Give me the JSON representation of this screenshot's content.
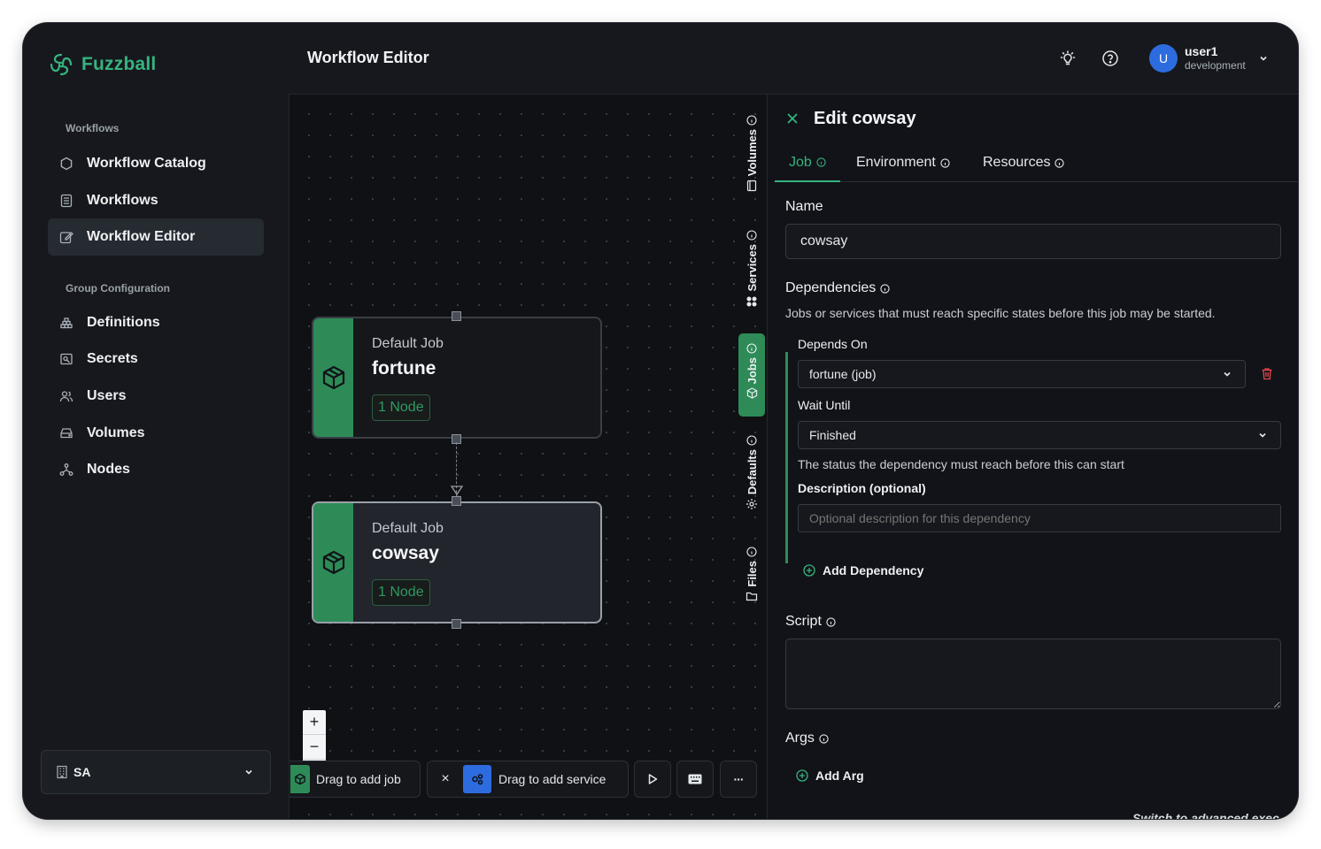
{
  "brand": {
    "name": "Fuzzball",
    "color": "#36b37e"
  },
  "sidebar": {
    "workflows_label": "Workflows",
    "workflows": [
      {
        "label": "Workflow Catalog",
        "icon": "hexagon-icon"
      },
      {
        "label": "Workflows",
        "icon": "list-icon"
      },
      {
        "label": "Workflow Editor",
        "icon": "edit-icon",
        "active": true
      }
    ],
    "group_label": "Group Configuration",
    "group": [
      {
        "label": "Definitions",
        "icon": "stack-icon"
      },
      {
        "label": "Secrets",
        "icon": "secret-icon"
      },
      {
        "label": "Users",
        "icon": "users-icon"
      },
      {
        "label": "Volumes",
        "icon": "drive-icon"
      },
      {
        "label": "Nodes",
        "icon": "nodes-icon"
      }
    ],
    "org": "SA"
  },
  "header": {
    "title": "Workflow Editor",
    "user": {
      "initial": "U",
      "name": "user1",
      "org": "development"
    }
  },
  "canvas": {
    "nodes": [
      {
        "kind": "Default Job",
        "name": "fortune",
        "badge": "1 Node",
        "selected": false
      },
      {
        "kind": "Default Job",
        "name": "cowsay",
        "badge": "1 Node",
        "selected": true
      }
    ],
    "zoom_in": "+",
    "zoom_out": "−",
    "toolbar": {
      "add_job": "Drag to add job",
      "close": "×",
      "add_service": "Drag to add service",
      "more": "···"
    },
    "side_tabs": [
      {
        "label": "Volumes",
        "icon": "volume-icon",
        "active": false
      },
      {
        "label": "Services",
        "icon": "services-icon",
        "active": false
      },
      {
        "label": "Jobs",
        "icon": "jobs-icon",
        "active": true
      },
      {
        "label": "Defaults",
        "icon": "gear-icon",
        "active": false
      },
      {
        "label": "Files",
        "icon": "folder-icon",
        "active": false
      }
    ]
  },
  "panel": {
    "close": "×",
    "title": "Edit cowsay",
    "tabs": [
      {
        "label": "Job",
        "active": true
      },
      {
        "label": "Environment",
        "active": false
      },
      {
        "label": "Resources",
        "active": false
      }
    ],
    "name_label": "Name",
    "name_value": "cowsay",
    "dependencies_label": "Dependencies",
    "dependencies_help": "Jobs or services that must reach specific states before this job may be started.",
    "depends_on_label": "Depends On",
    "depends_on_value": "fortune (job)",
    "wait_until_label": "Wait Until",
    "wait_until_value": "Finished",
    "wait_until_help": "The status the dependency must reach before this can start",
    "description_label": "Description (optional)",
    "description_placeholder": "Optional description for this dependency",
    "add_dependency": "Add Dependency",
    "script_label": "Script",
    "script_value": "",
    "args_label": "Args",
    "add_arg": "Add Arg",
    "advanced": "Switch to advanced exec"
  },
  "colors": {
    "accent": "#2e8b57",
    "danger": "#e5484d",
    "avatar": "#2d6cdf"
  }
}
